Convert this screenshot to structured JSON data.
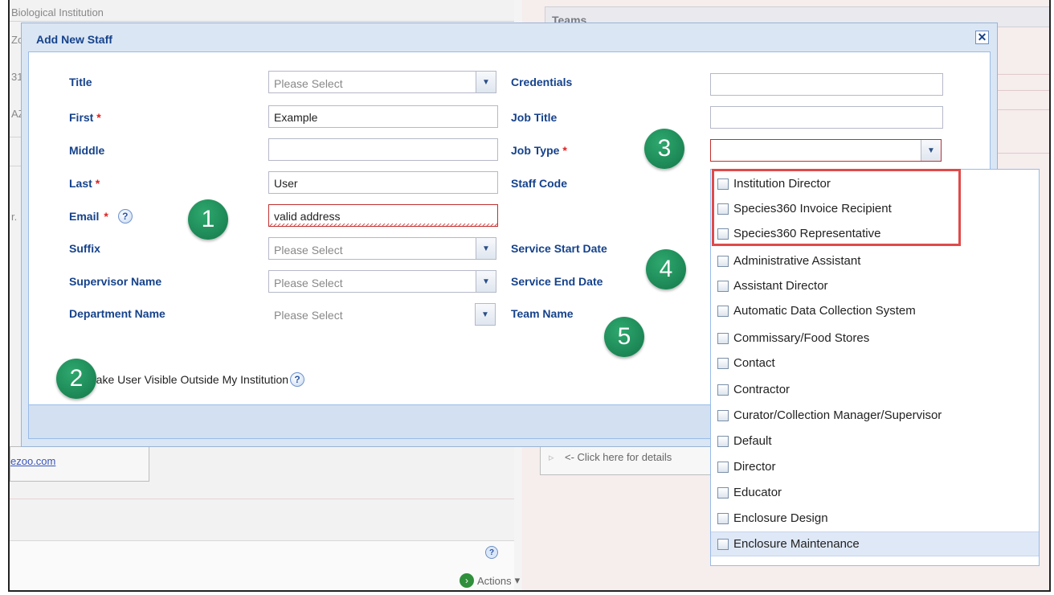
{
  "background": {
    "institution_label": "Biological Institution",
    "row_zo": "Zo",
    "row_31": "31",
    "row_az": "AZ",
    "row_r": "r.",
    "teams_header": "Teams",
    "email_link": "ezoo.com",
    "click_details": "<- Click here for details",
    "actions_label": "Actions"
  },
  "dialog": {
    "title": "Add New Staff",
    "close_symbol": "✕",
    "help_symbol": "?",
    "required_mark": "*",
    "fields_left": {
      "title_label": "Title",
      "title_value": "Please Select",
      "first_label": "First",
      "first_value": "Example",
      "middle_label": "Middle",
      "middle_value": "",
      "last_label": "Last",
      "last_value": "User",
      "email_label": "Email",
      "email_value": "valid address",
      "suffix_label": "Suffix",
      "suffix_value": "Please Select",
      "supervisor_label": "Supervisor Name",
      "supervisor_value": "Please Select",
      "department_label": "Department Name",
      "department_value": "Please Select"
    },
    "fields_right": {
      "credentials_label": "Credentials",
      "credentials_value": "",
      "job_title_label": "Job Title",
      "job_title_value": "",
      "job_type_label": "Job Type",
      "job_type_value": "",
      "staff_code_label": "Staff Code",
      "service_start_label": "Service Start Date",
      "service_end_label": "Service End Date",
      "team_name_label": "Team Name"
    },
    "visible_outside_label": "Make User Visible Outside My Institution",
    "visible_outside_checked": true
  },
  "callouts": [
    "1",
    "2",
    "3",
    "4",
    "5"
  ],
  "job_type_options": [
    "Institution Director",
    "Species360 Invoice Recipient",
    "Species360 Representative",
    "Administrative Assistant",
    "Assistant Director",
    "Automatic Data Collection System",
    "Commissary/Food Stores",
    "Contact",
    "Contractor",
    "Curator/Collection Manager/Supervisor",
    "Default",
    "Director",
    "Educator",
    "Enclosure Design",
    "Enclosure Maintenance"
  ],
  "colors": {
    "label_blue": "#15428b",
    "required_red": "#e02020",
    "callout_green": "#1e8f5a",
    "highlight_red": "#e04a4a"
  }
}
